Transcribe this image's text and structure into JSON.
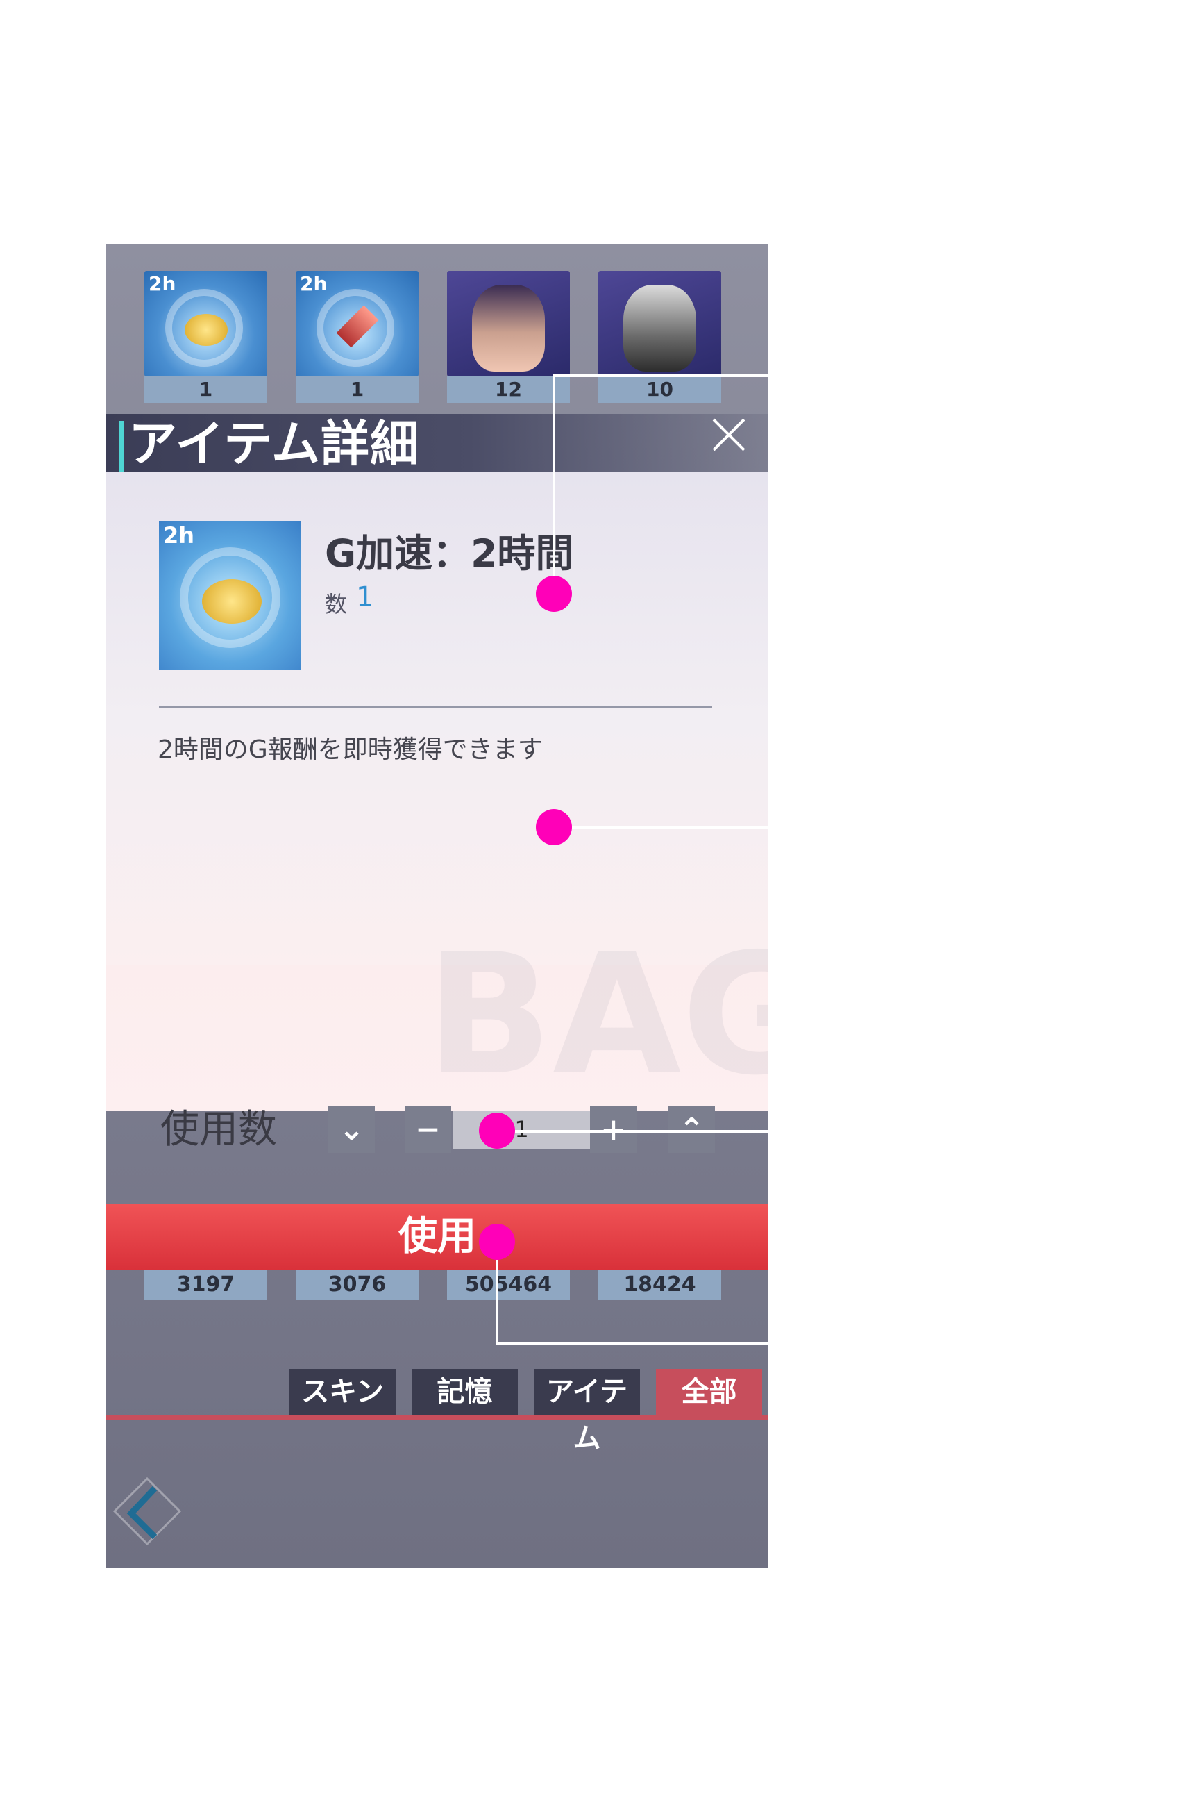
{
  "inventory": {
    "row1": [
      {
        "tag": "2h",
        "count": "1",
        "kind": "gold-boost"
      },
      {
        "tag": "2h",
        "count": "1",
        "kind": "gem-boost"
      },
      {
        "tag": "",
        "count": "12",
        "kind": "character-memory"
      },
      {
        "tag": "",
        "count": "10",
        "kind": "character-memory"
      }
    ],
    "row3_counts": [
      "3197",
      "3076",
      "505464",
      "18424"
    ]
  },
  "dialog": {
    "title": "アイテム詳細",
    "item": {
      "icon_tag": "2h",
      "name": "G加速：2時間",
      "qty_label": "数",
      "qty_value": "1",
      "description": "2時間のG報酬を即時獲得できます"
    },
    "use_count_label": "使用数",
    "use_count_value": "1",
    "use_button_label": "使用",
    "watermark": "BAG"
  },
  "tabs": [
    "スキン",
    "記憶",
    "アイテム",
    "全部"
  ],
  "active_tab": "全部",
  "colors": {
    "accent_teal": "#4fd5d3",
    "use_button_red": "#e0383e",
    "active_tab_red": "#c74e5c",
    "quantity_blue": "#2f8fd0",
    "annotation_dot": "#ff00b8"
  }
}
